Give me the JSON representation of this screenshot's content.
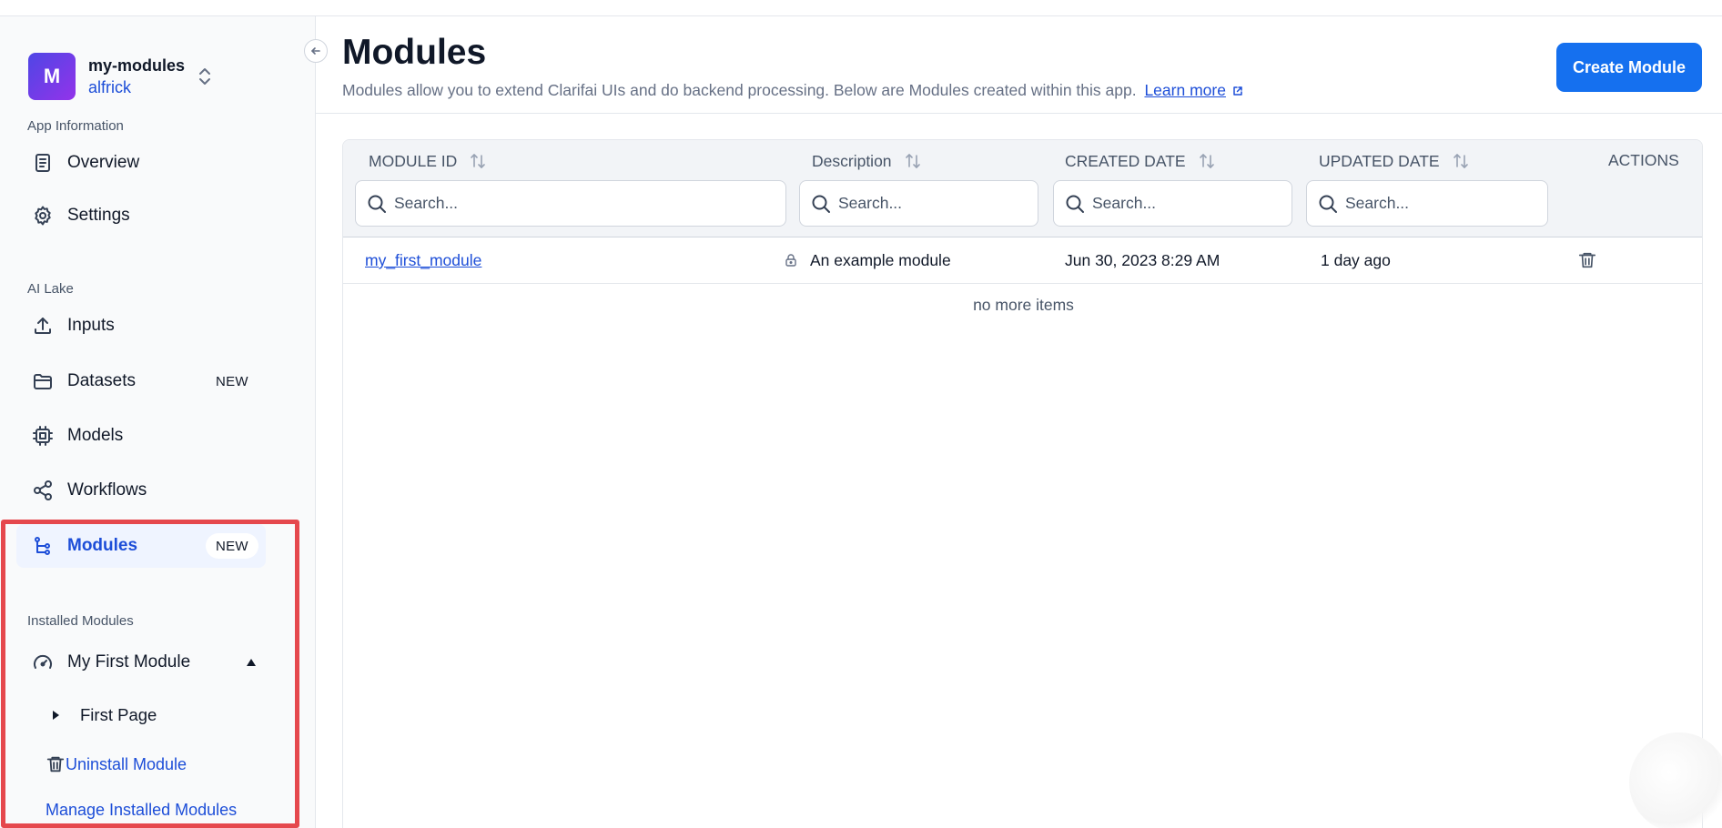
{
  "app": {
    "avatar_letter": "M",
    "name": "my-modules",
    "user": "alfrick"
  },
  "sidebar": {
    "sections": {
      "app_information": "App Information",
      "ai_lake": "AI Lake",
      "installed_modules": "Installed Modules"
    },
    "items": {
      "overview": {
        "label": "Overview",
        "icon": "document-icon"
      },
      "settings": {
        "label": "Settings",
        "icon": "gear-icon"
      },
      "inputs": {
        "label": "Inputs",
        "icon": "upload-icon"
      },
      "datasets": {
        "label": "Datasets",
        "icon": "folder-icon",
        "badge": "NEW"
      },
      "models": {
        "label": "Models",
        "icon": "chip-icon"
      },
      "workflows": {
        "label": "Workflows",
        "icon": "share-icon"
      },
      "modules": {
        "label": "Modules",
        "icon": "module-tree-icon",
        "badge": "NEW",
        "active": true
      }
    },
    "installed": {
      "module_name": "My First Module",
      "page_name": "First Page",
      "uninstall_label": "Uninstall Module",
      "manage_label": "Manage Installed Modules"
    },
    "highlight_color": "#e5484d"
  },
  "main": {
    "title": "Modules",
    "description": "Modules allow you to extend Clarifai UIs and do backend processing. Below are Modules created within this app.",
    "learn_more": "Learn more",
    "create_button": "Create Module",
    "table": {
      "columns": {
        "module_id": "MODULE ID",
        "description": "Description",
        "created_date": "CREATED DATE",
        "updated_date": "UPDATED DATE",
        "actions": "ACTIONS"
      },
      "search_placeholder": "Search...",
      "rows": [
        {
          "module_id": "my_first_module",
          "description": "An example module",
          "created_date": "Jun 30, 2023 8:29 AM",
          "updated_date": "1 day ago"
        }
      ],
      "footer": "no more items"
    }
  },
  "colors": {
    "accent": "#1570ef",
    "link": "#1d4ed8",
    "active_bg": "#eff4ff"
  }
}
